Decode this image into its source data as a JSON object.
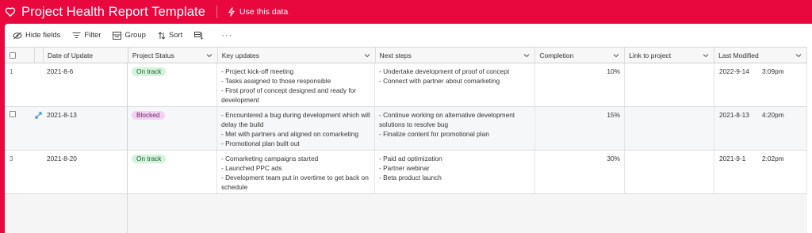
{
  "header": {
    "title": "Project Health Report Template",
    "use_data_label": "Use this data"
  },
  "toolbar": {
    "hide_fields": "Hide fields",
    "filter": "Filter",
    "group": "Group",
    "sort": "Sort",
    "more": "···"
  },
  "columns": {
    "date": "Date of Update",
    "status": "Project Status",
    "updates": "Key updates",
    "next": "Next steps",
    "completion": "Completion",
    "link": "Link to project",
    "modified": "Last Modified"
  },
  "rows": [
    {
      "num": "1",
      "date": "2021-8-6",
      "status": "On track",
      "updates": [
        "- Project kick-off meeting",
        "- Tasks assigned to those responsible",
        "- First proof of concept designed and ready for",
        "development"
      ],
      "next": [
        "- Undertake development of proof of concept",
        "- Connect with partner about comarketing"
      ],
      "completion": "10%",
      "mod_date": "2022-9-14",
      "mod_time": "3:09pm"
    },
    {
      "num": "",
      "date": "2021-8-13",
      "status": "Blocked",
      "updates": [
        "- Encountered a bug during development which will",
        "delay the build",
        "- Met with partners and aligned on comarketing",
        "- Promotional plan built out"
      ],
      "next": [
        "- Continue working on alternative development",
        "solutions to resolve bug",
        "- Finalize content for promotional plan"
      ],
      "completion": "15%",
      "mod_date": "2021-8-13",
      "mod_time": "4:20pm"
    },
    {
      "num": "3",
      "date": "2021-8-20",
      "status": "On track",
      "updates": [
        "- Comarketing campaigns started",
        "- Launched PPC ads",
        "- Development team put in overtime to get back on",
        "schedule"
      ],
      "next": [
        "- Paid ad optimization",
        "- Partner webinar",
        "- Beta product launch"
      ],
      "completion": "30%",
      "mod_date": "2021-9-1",
      "mod_time": "2:02pm"
    }
  ]
}
